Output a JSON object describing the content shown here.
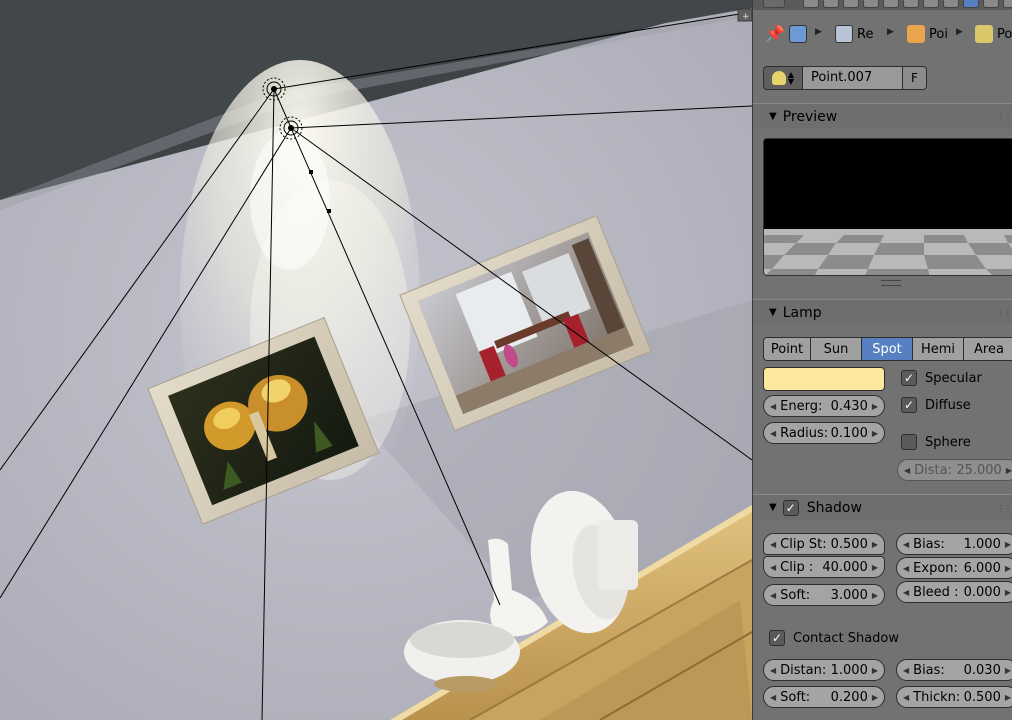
{
  "header": {
    "breadcrumb": [
      {
        "label": "",
        "icon": "world-texture-icon"
      },
      {
        "label": "Re",
        "icon": "render-layer-icon"
      },
      {
        "label": "Poi",
        "icon": "object-cube-icon"
      },
      {
        "label": "Po",
        "icon": "lamp-data-icon"
      }
    ],
    "pin_icon": "pin-icon"
  },
  "datablock": {
    "name": "Point.007",
    "fake_user_label": "F"
  },
  "panels": {
    "preview": {
      "title": "Preview"
    },
    "lamp": {
      "title": "Lamp",
      "types": [
        "Point",
        "Sun",
        "Spot",
        "Hemi",
        "Area"
      ],
      "active_type": "Spot",
      "color": "#fde99e",
      "energy": {
        "label": "Energ:",
        "value": "0.430"
      },
      "radius": {
        "label": "Radius:",
        "value": "0.100"
      },
      "specular": {
        "label": "Specular",
        "checked": true
      },
      "diffuse": {
        "label": "Diffuse",
        "checked": true
      },
      "sphere": {
        "label": "Sphere",
        "checked": false
      },
      "distance": {
        "label": "Dista:",
        "value": "25.000"
      }
    },
    "shadow": {
      "title": "Shadow",
      "enabled": true,
      "clip_start": {
        "label": "Clip St:",
        "value": "0.500"
      },
      "clip_end": {
        "label": "Clip :",
        "value": "40.000"
      },
      "soft": {
        "label": "Soft:",
        "value": "3.000"
      },
      "bias": {
        "label": "Bias:",
        "value": "1.000"
      },
      "exponent": {
        "label": "Expon:",
        "value": "6.000"
      },
      "bleed": {
        "label": "Bleed :",
        "value": "0.000"
      },
      "contact_shadow": {
        "label": "Contact Shadow",
        "checked": true
      },
      "contact_distance": {
        "label": "Distan:",
        "value": "1.000"
      },
      "contact_bias": {
        "label": "Bias:",
        "value": "0.030"
      },
      "contact_soft": {
        "label": "Soft:",
        "value": "0.200"
      },
      "contact_thickness": {
        "label": "Thickn:",
        "value": "0.500"
      }
    }
  },
  "colors": {
    "accent": "#5680c2",
    "panel_bg": "#727272",
    "lamp_color": "#fde99e"
  }
}
